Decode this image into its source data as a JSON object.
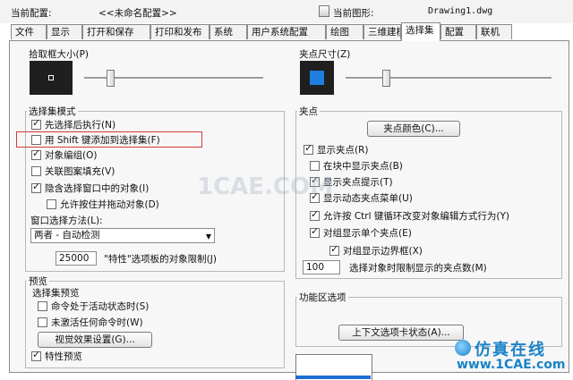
{
  "header": {
    "profile_label": "当前配置:",
    "profile_value": "<<未命名配置>>",
    "drawing_label": "当前图形:",
    "drawing_value": "Drawing1.dwg"
  },
  "tabs": [
    "文件",
    "显示",
    "打开和保存",
    "打印和发布",
    "系统",
    "用户系统配置",
    "绘图",
    "三维建模",
    "选择集",
    "配置",
    "联机"
  ],
  "active_tab": "选择集",
  "pickbox": {
    "label": "拾取框大小(P)",
    "level": 0.35
  },
  "grip_size": {
    "label": "夹点尺寸(Z)",
    "level": 0.35
  },
  "selection_modes": {
    "title": "选择集模式",
    "items": [
      {
        "label": "先选择后执行(N)",
        "checked": true
      },
      {
        "label": "用 Shift 键添加到选择集(F)",
        "checked": false
      },
      {
        "label": "对象编组(O)",
        "checked": true
      },
      {
        "label": "关联图案填充(V)",
        "checked": false
      },
      {
        "label": "隐含选择窗口中的对象(I)",
        "checked": true
      },
      {
        "label": "允许按住并拖动对象(D)",
        "checked": false
      }
    ],
    "window_method_label": "窗口选择方法(L):",
    "window_method_value": "两者 - 自动检测",
    "limit_value": "25000",
    "limit_label": "\"特性\"选项板的对象限制(J)"
  },
  "preview": {
    "title": "预览",
    "subtitle": "选择集预览",
    "items": [
      {
        "label": "命令处于活动状态时(S)",
        "checked": false
      },
      {
        "label": "未激活任何命令时(W)",
        "checked": false
      }
    ],
    "visual_button": "视觉效果设置(G)...",
    "props_preview": {
      "label": "特性预览",
      "checked": true
    }
  },
  "grips": {
    "title": "夹点",
    "color_button": "夹点颜色(C)...",
    "items": [
      {
        "label": "显示夹点(R)",
        "checked": true
      },
      {
        "label": "在块中显示夹点(B)",
        "checked": false
      },
      {
        "label": "显示夹点提示(T)",
        "checked": true
      },
      {
        "label": "显示动态夹点菜单(U)",
        "checked": true
      },
      {
        "label": "允许按 Ctrl 键循环改变对象编辑方式行为(Y)",
        "checked": true
      },
      {
        "label": "对组显示单个夹点(E)",
        "checked": true
      },
      {
        "label": "对组显示边界框(X)",
        "checked": true
      }
    ],
    "limit_value": "100",
    "limit_label": "选择对象时限制显示的夹点数(M)"
  },
  "ribbon": {
    "title": "功能区选项",
    "button": "上下文选项卡状态(A)..."
  },
  "watermark": {
    "mid": "1CAE.COM",
    "logo_zh": "仿真在线",
    "logo_url": "www.1CAE.com"
  },
  "colors": {
    "pick_preview_bg": "#1f1f1f",
    "grip_color": "#1f7fe0",
    "highlight": "#d23a3a",
    "logo": "#1a83c8"
  }
}
